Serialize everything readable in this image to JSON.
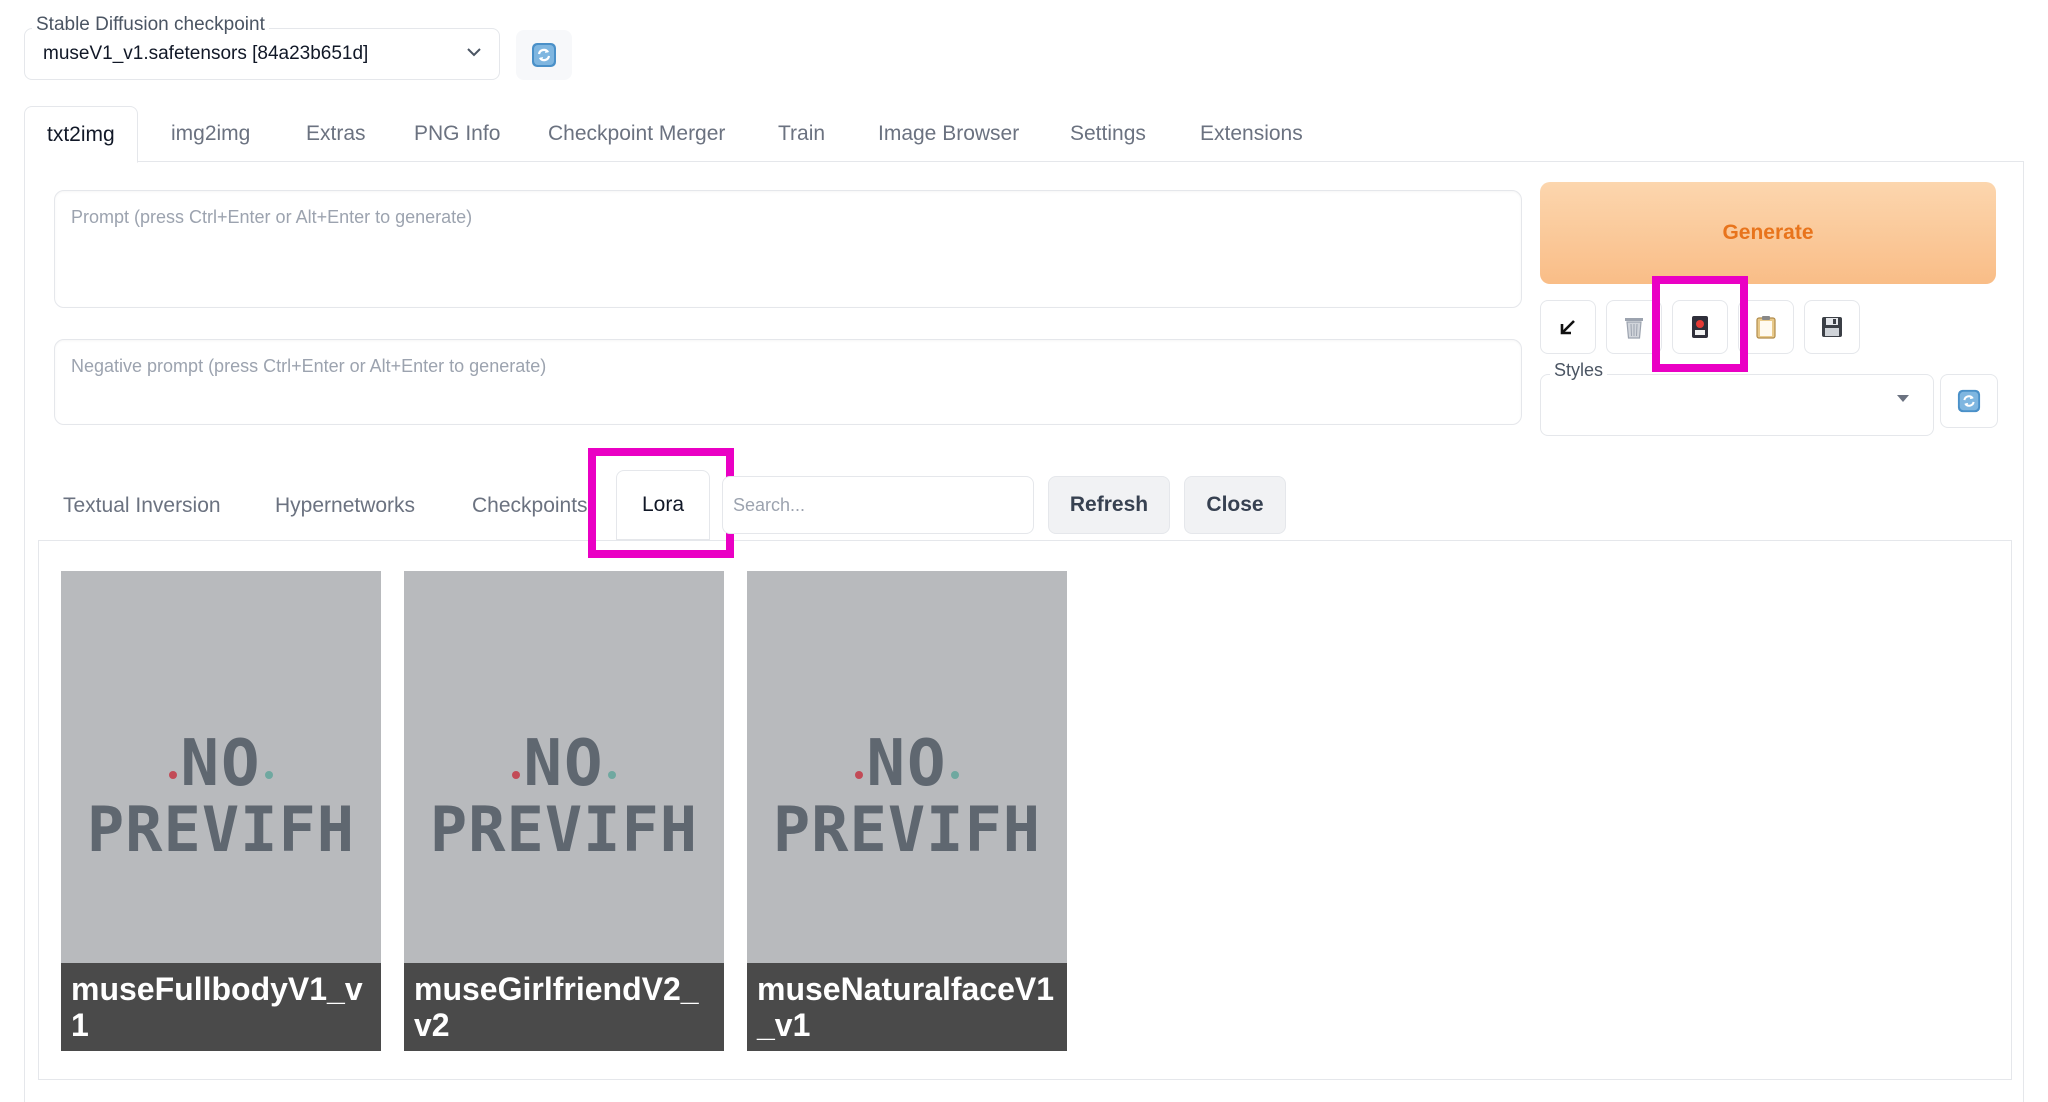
{
  "checkpoint": {
    "label": "Stable Diffusion checkpoint",
    "value": "museV1_v1.safetensors [84a23b651d]"
  },
  "tabs": [
    "txt2img",
    "img2img",
    "Extras",
    "PNG Info",
    "Checkpoint Merger",
    "Train",
    "Image Browser",
    "Settings",
    "Extensions"
  ],
  "prompt": {
    "placeholder": "Prompt (press Ctrl+Enter or Alt+Enter to generate)",
    "negative_placeholder": "Negative prompt (press Ctrl+Enter or Alt+Enter to generate)"
  },
  "generate_label": "Generate",
  "toolbar": {
    "icons": [
      "arrow-down-left-icon",
      "trash-icon",
      "red-card-icon",
      "clipboard-icon",
      "save-icon"
    ]
  },
  "styles": {
    "label": "Styles",
    "value": ""
  },
  "extra_networks": {
    "tabs": [
      "Textual Inversion",
      "Hypernetworks",
      "Checkpoints",
      "Lora"
    ],
    "active_tab": "Lora",
    "search_placeholder": "Search...",
    "refresh_label": "Refresh",
    "close_label": "Close",
    "cards": [
      {
        "name": "museFullbodyV1_v1",
        "preview_line1": "NO",
        "preview_line2": "PREVIFH"
      },
      {
        "name": "museGirlfriendV2_v2",
        "preview_line1": "NO",
        "preview_line2": "PREVIFH"
      },
      {
        "name": "museNaturalfaceV1_v1",
        "preview_line1": "NO",
        "preview_line2": "PREVIFH"
      }
    ]
  },
  "colors": {
    "accent": "#e8741c",
    "highlight": "#ea00c4",
    "card_bg": "#b8babd",
    "caption_bg": "#404040"
  }
}
